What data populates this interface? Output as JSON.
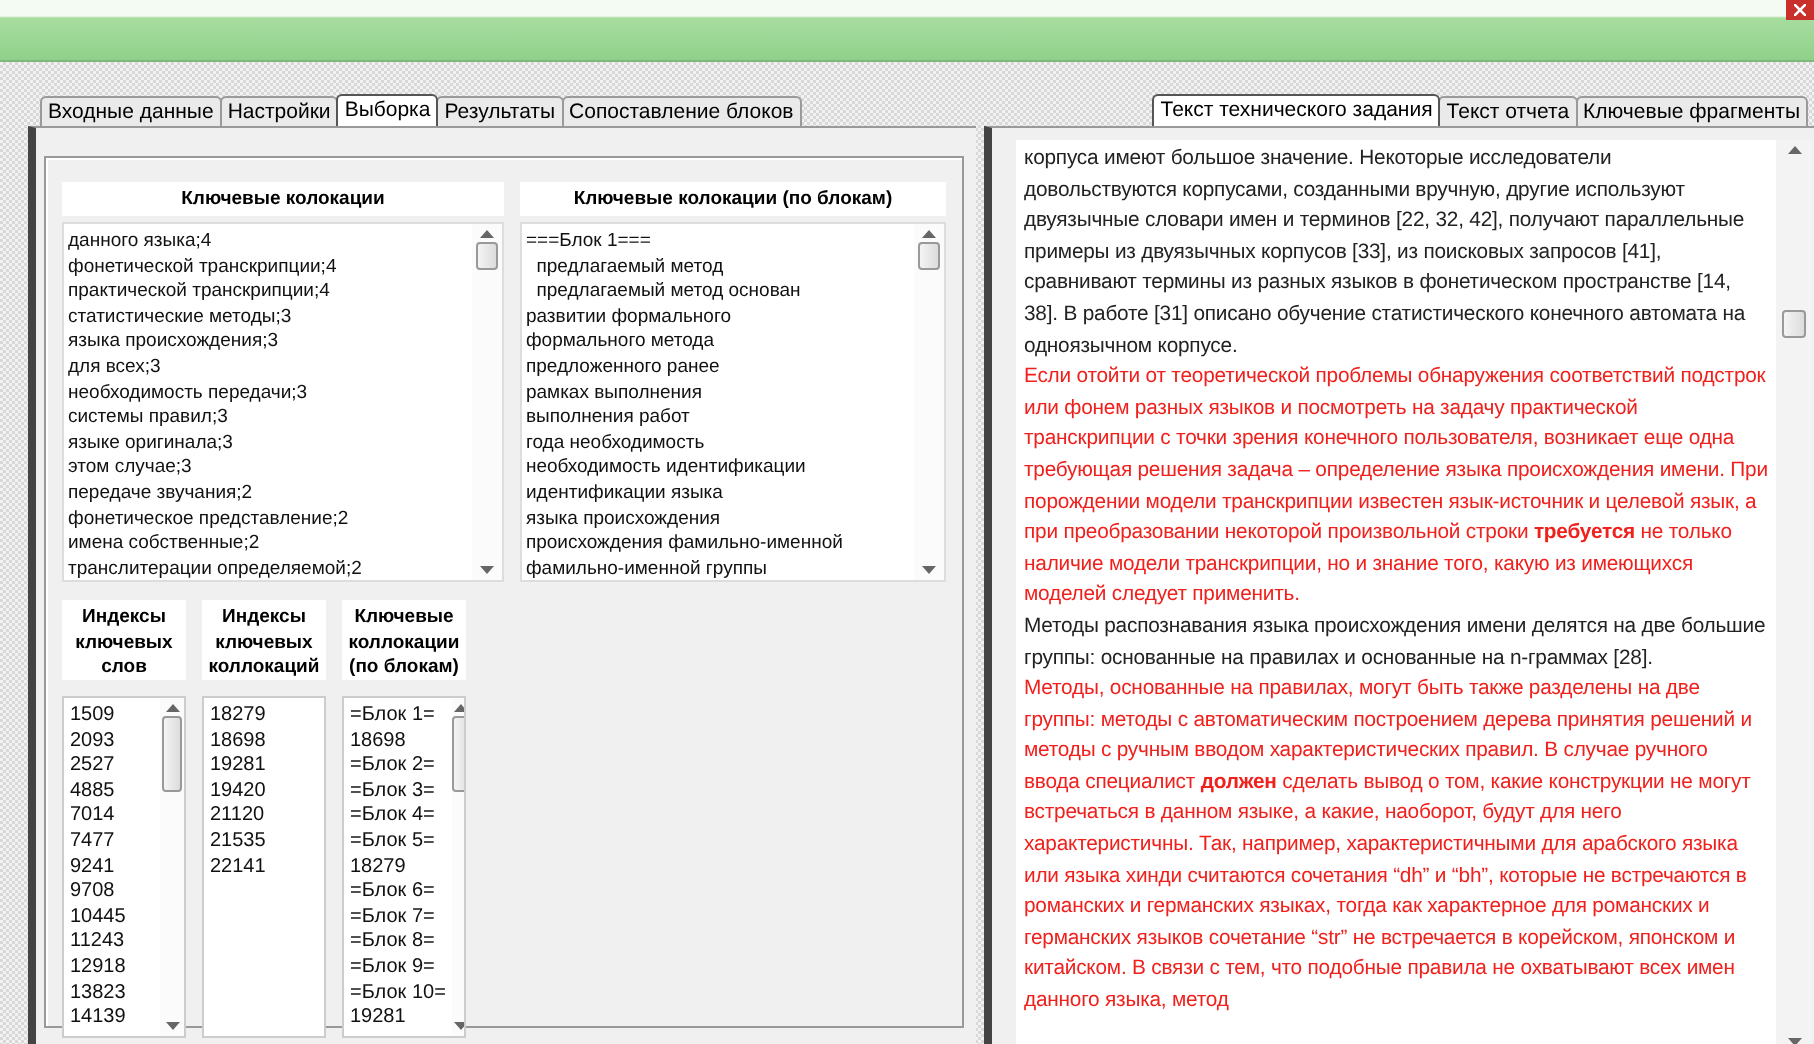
{
  "left_tabs": [
    {
      "label": "Входные данные",
      "selected": false
    },
    {
      "label": "Настройки",
      "selected": false
    },
    {
      "label": "Выборка",
      "selected": true
    },
    {
      "label": "Результаты",
      "selected": false
    },
    {
      "label": "Сопоставление блоков",
      "selected": false
    }
  ],
  "right_tabs": [
    {
      "label": "Текст технического задания",
      "selected": true
    },
    {
      "label": "Текст отчета",
      "selected": false
    },
    {
      "label": "Ключевые фрагменты",
      "selected": false
    }
  ],
  "keyword_panels": [
    {
      "title": "Ключевые колокации",
      "items": [
        "данного языка;4",
        "фонетической транскрипции;4",
        "практической транскрипции;4",
        "статистические методы;3",
        "языка происхождения;3",
        "для всех;3",
        "необходимость передачи;3",
        "системы правил;3",
        "языке оригинала;3",
        "этом случае;3",
        "передаче звучания;2",
        "фонетическое представление;2",
        "имена собственные;2",
        "транслитерации определяемой;2"
      ]
    },
    {
      "title": "Ключевые колокации (по блокам)",
      "items": [
        "===Блок 1===",
        "  предлагаемый метод",
        "  предлагаемый метод основан",
        "развитии формального",
        "формального метода",
        "предложенного ранее",
        "рамках выполнения",
        "выполнения работ",
        "года необходимость",
        "необходимость идентификации",
        "идентификации языка",
        "языка происхождения",
        "происхождения фамильно-именной",
        "фамильно-именной группы"
      ]
    }
  ],
  "index_panels": [
    {
      "title": "Индексы ключевых слов",
      "scrollable": true,
      "items": [
        "1509",
        "2093",
        "2527",
        "4885",
        "7014",
        "7477",
        "9241",
        "9708",
        "10445",
        "11243",
        "12918",
        "13823",
        "14139"
      ]
    },
    {
      "title": "Индексы ключевых коллокаций",
      "scrollable": false,
      "items": [
        "18279",
        "18698",
        "19281",
        "19420",
        "21120",
        "21535",
        "22141"
      ]
    },
    {
      "title": "Ключевые коллокации (по блокам)",
      "scrollable": true,
      "items": [
        "=Блок 1=",
        "18698",
        "=Блок 2=",
        "=Блок 3=",
        "=Блок 4=",
        "=Блок 5=",
        "18279",
        "=Блок 6=",
        "=Блок 7=",
        "=Блок 8=",
        "=Блок 9=",
        "=Блок 10=",
        "19281"
      ]
    }
  ],
  "document": {
    "paragraphs": [
      {
        "kind": "plain",
        "text": "корпуса имеют большое значение. Некоторые исследователи довольствуются корпусами, созданными вручную, другие используют двуязычные словари имен и терминов [22, 32, 42], получают параллельные примеры из двуязычных корпусов [33], из поисковых запросов [41], сравнивают термины из разных языков в фонетическом пространстве [14, 38]. В работе [31] описано обучение статистического конечного автомата на одноязычном корпусе."
      },
      {
        "kind": "highlight",
        "text": "Если отойти от теоретической проблемы обнаружения соответствий подстрок или фонем разных языков и посмотреть на задачу практической транскрипции с точки зрения конечного пользователя, возникает еще одна требующая решения задача – определение языка происхождения имени. При порождении модели транскрипции известен язык-источник и целевой язык, а при преобразовании некоторой произвольной строки **требуется** не только наличие модели транскрипции, но и знание того, какую из имеющихся моделей следует применить."
      },
      {
        "kind": "plain",
        "text": "Методы распознавания языка происхождения имени делятся на две большие группы: основанные на правилах и основанные на n-граммах [28]."
      },
      {
        "kind": "highlight",
        "text": "Методы, основанные на правилах, могут быть также разделены на две группы: методы с автоматическим построением дерева принятия решений и методы с ручным вводом характеристических правил. В случае ручного ввода специалист **должен** сделать вывод о том, какие конструкции не могут встречаться в данном языке, а какие, наоборот, будут для него характеристичны. Так, например, характеристичными для арабского языка или языка хинди считаются сочетания “dh” и “bh”, которые не встречаются в романских и германских языках, тогда как характерное для романских и германских языков сочетание “str” не встречается в корейском, японском и китайском. В связи с тем, что подобные правила не охватывают всех имен данного языка, метод"
      }
    ]
  }
}
